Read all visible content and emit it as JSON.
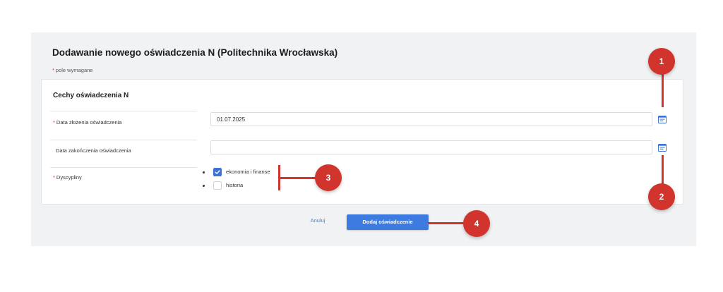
{
  "form": {
    "title": "Dodawanie nowego oświadczenia N (Politechnika Wrocławska)",
    "required_star": "*",
    "required_note": "pole wymagane",
    "section_title": "Cechy oświadczenia N",
    "fields": {
      "date_submitted": {
        "label": "Data złożenia oświadczenia",
        "required": true,
        "value": "01.07.2025"
      },
      "date_end": {
        "label": "Data zakończenia oświadczenia",
        "required": false,
        "value": ""
      },
      "disciplines": {
        "label": "Dyscypliny",
        "required": true,
        "options": [
          {
            "label": "ekonomia i finanse",
            "checked": true
          },
          {
            "label": "historia",
            "checked": false
          }
        ]
      }
    },
    "cancel_label": "Anuluj",
    "submit_label": "Dodaj oświadczenie"
  },
  "annotations": [
    "1",
    "2",
    "3",
    "4"
  ],
  "icons": {
    "calendar": "calendar-icon",
    "check": "check-icon"
  },
  "colors": {
    "accent": "#3d7be0",
    "annotation": "#d0342c",
    "panel_bg": "#f1f2f4"
  }
}
